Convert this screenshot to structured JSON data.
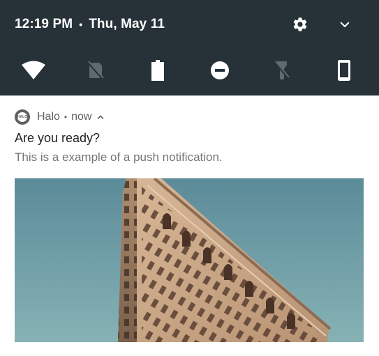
{
  "status_bar": {
    "time": "12:19 PM",
    "separator": "•",
    "date": "Thu, May 11"
  },
  "header_actions": {
    "settings_icon": "gear-icon",
    "expand_icon": "chevron-down-icon"
  },
  "quick_settings": [
    {
      "name": "wifi",
      "icon": "wifi-icon",
      "state": "on"
    },
    {
      "name": "no-sim",
      "icon": "no-sim-icon",
      "state": "off"
    },
    {
      "name": "battery",
      "icon": "battery-icon",
      "state": "on"
    },
    {
      "name": "do-not-disturb",
      "icon": "do-not-disturb-icon",
      "state": "on"
    },
    {
      "name": "flashlight",
      "icon": "flashlight-icon",
      "state": "off"
    },
    {
      "name": "screen-rotation",
      "icon": "phone-icon",
      "state": "on"
    }
  ],
  "notification": {
    "app_name": "Halo",
    "separator": "•",
    "time": "now",
    "app_icon_text": "HALO",
    "title": "Are you ready?",
    "text": "This is a example of a push notification.",
    "image": "building-photo"
  },
  "colors": {
    "shade_bg": "#263238",
    "icon_active": "#ffffff",
    "icon_inactive": "#5d6a70",
    "title_text": "#212121",
    "body_text": "#757575",
    "sky": "#6f9ea8",
    "building": "#c9a685"
  }
}
